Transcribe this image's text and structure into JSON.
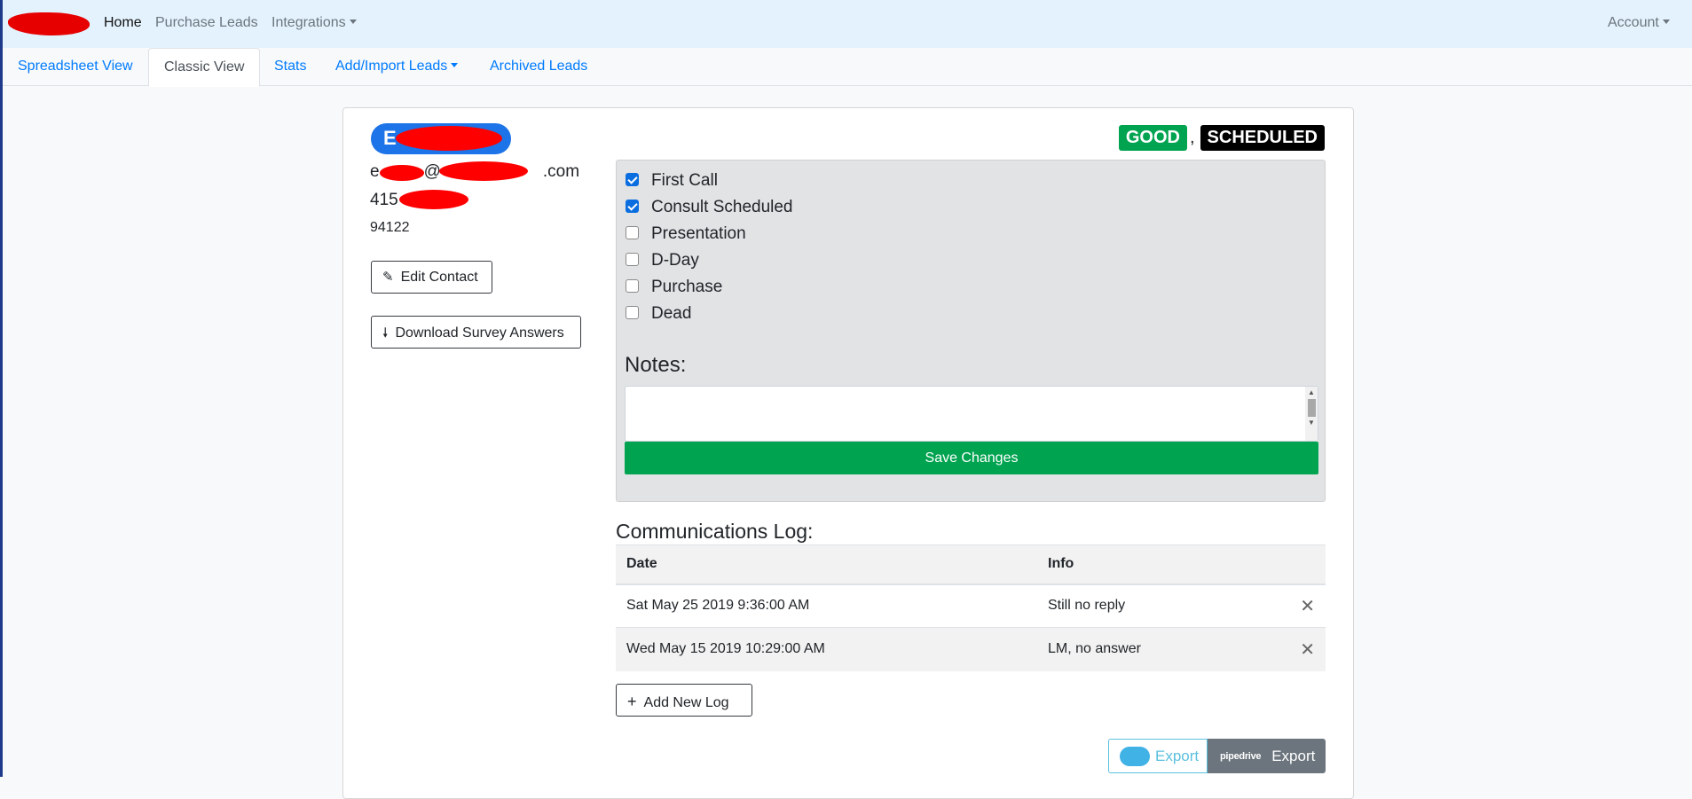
{
  "navbar": {
    "items": [
      {
        "label": "Home"
      },
      {
        "label": "Purchase Leads"
      },
      {
        "label": "Integrations"
      }
    ],
    "account": "Account"
  },
  "tabs": [
    {
      "label": "Spreadsheet View"
    },
    {
      "label": "Classic View"
    },
    {
      "label": "Stats"
    },
    {
      "label": "Add/Import Leads"
    },
    {
      "label": "Archived Leads"
    }
  ],
  "contact": {
    "name_initial": "E",
    "email_prefix": "e",
    "email_at": "@",
    "email_suffix": ".com",
    "phone_prefix": "415",
    "zip": "94122",
    "edit_label": "Edit Contact",
    "download_label": "Download Survey Answers"
  },
  "status": {
    "quality": "GOOD",
    "separator": ",",
    "stage": "SCHEDULED",
    "colors": {
      "good": "#00a34f",
      "scheduled": "#000000"
    }
  },
  "stages": [
    {
      "label": "First Call",
      "checked": true
    },
    {
      "label": "Consult Scheduled",
      "checked": true
    },
    {
      "label": "Presentation",
      "checked": false
    },
    {
      "label": "D-Day",
      "checked": false
    },
    {
      "label": "Purchase",
      "checked": false
    },
    {
      "label": "Dead",
      "checked": false
    }
  ],
  "notes": {
    "label": "Notes:",
    "value": "",
    "save_label": "Save Changes"
  },
  "log": {
    "title": "Communications Log:",
    "columns": [
      "Date",
      "Info"
    ],
    "rows": [
      {
        "date": "Sat May 25 2019 9:36:00 AM",
        "info": "Still no reply"
      },
      {
        "date": "Wed May 15 2019 10:29:00 AM",
        "info": "LM, no answer"
      }
    ],
    "add_label": "Add New Log"
  },
  "export": {
    "salesforce_label": "Export",
    "salesforce_logo": "salesforce",
    "pipedrive_label": "Export",
    "pipedrive_logo": "pipedrive"
  }
}
